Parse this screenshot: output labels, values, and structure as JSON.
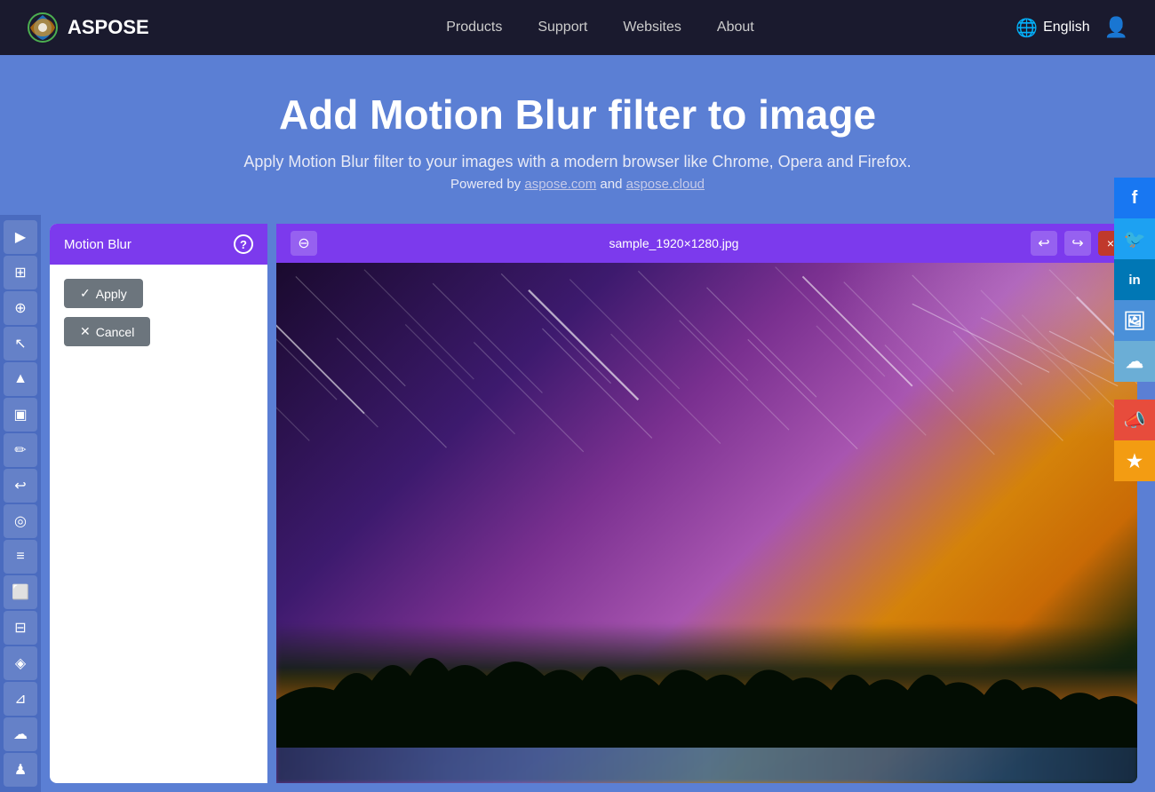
{
  "app": {
    "logo_text": "ASPOSE",
    "logo_icon": "🌀"
  },
  "navbar": {
    "links": [
      {
        "label": "Products",
        "id": "products"
      },
      {
        "label": "Support",
        "id": "support"
      },
      {
        "label": "Websites",
        "id": "websites"
      },
      {
        "label": "About",
        "id": "about"
      }
    ],
    "language": "English",
    "language_icon": "🌐"
  },
  "hero": {
    "title": "Add Motion Blur filter to image",
    "subtitle": "Apply Motion Blur filter to your images with a modern browser like Chrome, Opera and Firefox.",
    "powered_text": "Powered by",
    "powered_link1": "aspose.com",
    "powered_link2": "aspose.cloud",
    "powered_connector": "and"
  },
  "toolbar": {
    "tools": [
      {
        "id": "forward",
        "label": "Forward",
        "icon": "▶"
      },
      {
        "id": "layers",
        "label": "Layers",
        "icon": "⊞"
      },
      {
        "id": "zoom",
        "label": "Zoom",
        "icon": "⊕"
      },
      {
        "id": "pointer",
        "label": "Pointer",
        "icon": "↖"
      },
      {
        "id": "mountain",
        "label": "Mountain",
        "icon": "▲"
      },
      {
        "id": "photo",
        "label": "Photo",
        "icon": "▣"
      },
      {
        "id": "draw",
        "label": "Draw",
        "icon": "✏"
      },
      {
        "id": "undo",
        "label": "Undo",
        "icon": "↩"
      },
      {
        "id": "eye",
        "label": "Eye",
        "icon": "◎"
      },
      {
        "id": "document",
        "label": "Document",
        "icon": "≡"
      },
      {
        "id": "picture",
        "label": "Picture",
        "icon": "⬜"
      },
      {
        "id": "grid",
        "label": "Grid",
        "icon": "⊞"
      },
      {
        "id": "color",
        "label": "Color",
        "icon": "◈"
      },
      {
        "id": "adjust",
        "label": "Adjust",
        "icon": "⊿"
      },
      {
        "id": "cloud",
        "label": "Cloud",
        "icon": "☁"
      },
      {
        "id": "user",
        "label": "User",
        "icon": "♟"
      }
    ]
  },
  "filter_panel": {
    "title": "Motion Blur",
    "help_label": "?",
    "apply_label": "Apply",
    "cancel_label": "Cancel"
  },
  "image_viewer": {
    "filename": "sample_1920×1280.jpg",
    "close_icon": "×",
    "undo_icon": "↩",
    "redo_icon": "↪",
    "zoom_out_icon": "⊖"
  },
  "social": [
    {
      "id": "facebook",
      "label": "f",
      "color": "#1877f2"
    },
    {
      "id": "twitter",
      "label": "🐦",
      "color": "#1da1f2"
    },
    {
      "id": "linkedin",
      "label": "in",
      "color": "#0077b5"
    },
    {
      "id": "image-share",
      "label": "🖼",
      "color": "#4a90d9"
    },
    {
      "id": "cloud-share",
      "label": "☁",
      "color": "#6baed6"
    },
    {
      "id": "announce",
      "label": "📣",
      "color": "#e74c3c"
    },
    {
      "id": "star",
      "label": "★",
      "color": "#f39c12"
    }
  ]
}
